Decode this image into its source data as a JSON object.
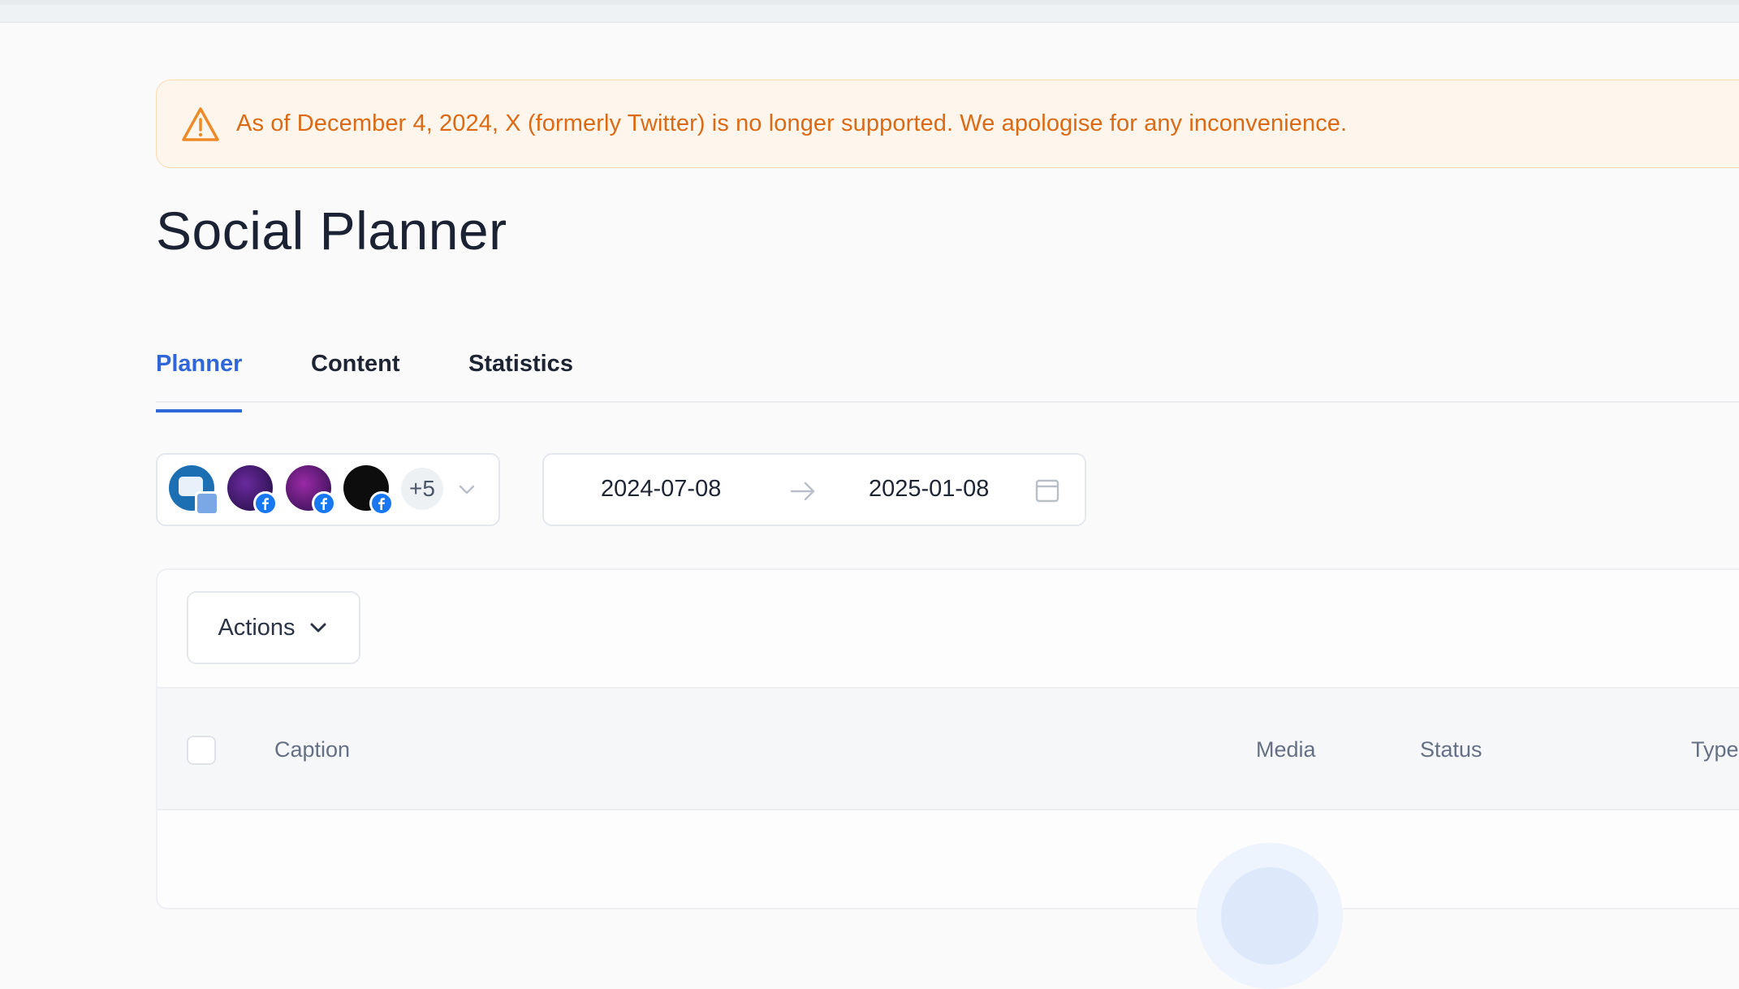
{
  "alert": {
    "message": "As of December 4, 2024, X (formerly Twitter) is no longer supported. We apologise for any inconvenience.",
    "icon": "warning-triangle-icon",
    "color": "#dc6a14"
  },
  "page": {
    "title": "Social Planner"
  },
  "tabs": [
    {
      "label": "Planner",
      "active": true
    },
    {
      "label": "Content",
      "active": false
    },
    {
      "label": "Statistics",
      "active": false
    }
  ],
  "accounts": {
    "avatars": [
      {
        "name": "google-business-account",
        "badge": "google-business-icon"
      },
      {
        "name": "facebook-account-1",
        "badge": "facebook-icon"
      },
      {
        "name": "facebook-account-2",
        "badge": "facebook-icon"
      },
      {
        "name": "facebook-account-3",
        "badge": "facebook-icon"
      }
    ],
    "more_label": "+5"
  },
  "date_range": {
    "start": "2024-07-08",
    "end": "2025-01-08"
  },
  "toolbar": {
    "actions_label": "Actions"
  },
  "table": {
    "columns": [
      "Caption",
      "Media",
      "Status",
      "Type"
    ]
  },
  "colors": {
    "accent": "#2f66d8",
    "facebook": "#1877f2",
    "warning_bg": "#fef6ec"
  }
}
